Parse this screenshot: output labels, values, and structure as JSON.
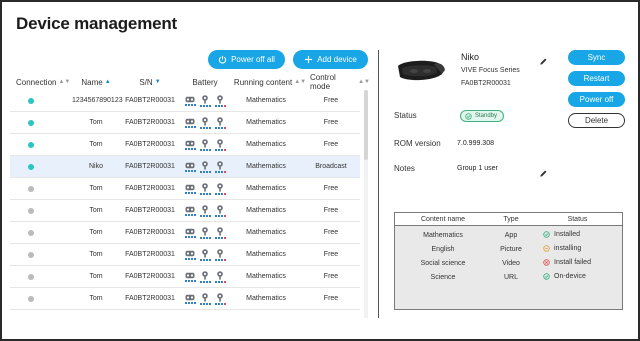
{
  "page": {
    "title": "Device management"
  },
  "toolbar": {
    "power_off_all": "Power off all",
    "add_device": "Add device"
  },
  "table": {
    "headers": {
      "connection": "Connection",
      "name": "Name",
      "sn": "S/N",
      "battery": "Battery",
      "running": "Running content",
      "control": "Control mode"
    },
    "rows": [
      {
        "connected": true,
        "name": "1234567890123",
        "sn": "FA0BT2R00031",
        "running": "Mathematics",
        "control": "Free",
        "selected": false
      },
      {
        "connected": true,
        "name": "Tom",
        "sn": "FA0BT2R00031",
        "running": "Mathematics",
        "control": "Free",
        "selected": false
      },
      {
        "connected": true,
        "name": "Tom",
        "sn": "FA0BT2R00031",
        "running": "Mathematics",
        "control": "Free",
        "selected": false
      },
      {
        "connected": true,
        "name": "Niko",
        "sn": "FA0BT2R00031",
        "running": "Mathematics",
        "control": "Broadcast",
        "selected": true
      },
      {
        "connected": false,
        "name": "Tom",
        "sn": "FA0BT2R00031",
        "running": "Mathematics",
        "control": "Free",
        "selected": false
      },
      {
        "connected": false,
        "name": "Tom",
        "sn": "FA0BT2R00031",
        "running": "Mathematics",
        "control": "Free",
        "selected": false
      },
      {
        "connected": false,
        "name": "Tom",
        "sn": "FA0BT2R00031",
        "running": "Mathematics",
        "control": "Free",
        "selected": false
      },
      {
        "connected": false,
        "name": "Tom",
        "sn": "FA0BT2R00031",
        "running": "Mathematics",
        "control": "Free",
        "selected": false
      },
      {
        "connected": false,
        "name": "Tom",
        "sn": "FA0BT2R00031",
        "running": "Mathematics",
        "control": "Free",
        "selected": false
      },
      {
        "connected": false,
        "name": "Tom",
        "sn": "FA0BT2R00031",
        "running": "Mathematics",
        "control": "Free",
        "selected": false
      }
    ]
  },
  "detail": {
    "name": "Niko",
    "model": "VIVE Focus Series",
    "sn": "FA0BT2R00031",
    "buttons": {
      "sync": "Sync",
      "restart": "Restart",
      "power_off": "Power off",
      "delete": "Delete"
    },
    "status_label": "Status",
    "status_value": "Standby",
    "rom_label": "ROM version",
    "rom_value": "7.0.999.308",
    "notes_label": "Notes",
    "notes_value": "Group 1 user"
  },
  "content_table": {
    "headers": {
      "name": "Content name",
      "type": "Type",
      "status": "Status"
    },
    "rows": [
      {
        "name": "Mathematics",
        "type": "App",
        "status": "Installed",
        "state": "ok"
      },
      {
        "name": "English",
        "type": "Picture",
        "status": "installing",
        "state": "pending"
      },
      {
        "name": "Social science",
        "type": "Video",
        "status": "Install failed",
        "state": "error"
      },
      {
        "name": "Science",
        "type": "URL",
        "status": "On-device",
        "state": "ok"
      }
    ]
  },
  "colors": {
    "accent": "#18a6e6",
    "connected": "#2bc4c2",
    "disconnected": "#bbbbbb",
    "ok": "#3db37f",
    "pending": "#e0a53a",
    "error": "#e05050"
  }
}
